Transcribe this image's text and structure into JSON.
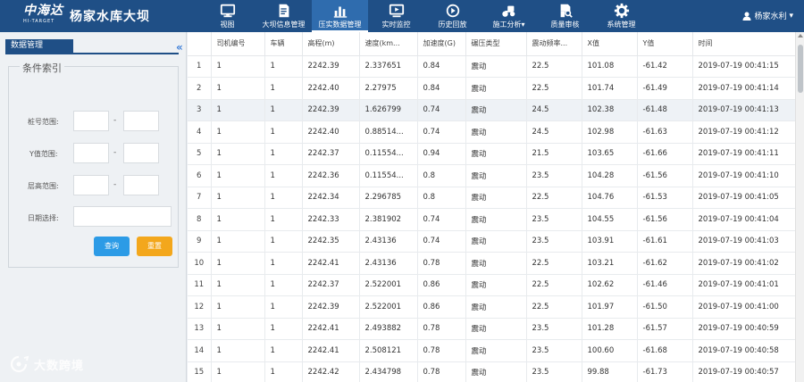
{
  "header": {
    "logo_main": "中海达",
    "logo_sub": "HI-TARGET",
    "title": "杨家水库大坝",
    "user": "杨家水利"
  },
  "nav": [
    {
      "label": "视图",
      "icon": "monitor-icon"
    },
    {
      "label": "大坝信息管理",
      "icon": "document-icon"
    },
    {
      "label": "压实数据管理",
      "icon": "bar-chart-icon",
      "active": true
    },
    {
      "label": "实时监控",
      "icon": "monitor-play-icon"
    },
    {
      "label": "历史回放",
      "icon": "replay-icon"
    },
    {
      "label": "施工分析",
      "icon": "roller-icon",
      "dropdown": true
    },
    {
      "label": "质量审核",
      "icon": "document-search-icon"
    },
    {
      "label": "系统管理",
      "icon": "gear-icon"
    }
  ],
  "sidebar": {
    "tab": "数据管理",
    "collapse": "«",
    "section": "条件索引",
    "fields": {
      "pile": "桩号范围:",
      "y": "Y值范围:",
      "height": "层高范围:",
      "date": "日期选择:"
    },
    "dash": "-",
    "query_btn": "查询",
    "reset_btn": "重置"
  },
  "table": {
    "columns": [
      "",
      "司机编号",
      "车辆",
      "高程(m)",
      "速度(km...",
      "加速度(G)",
      "碾压类型",
      "震动频率...",
      "X值",
      "Y值",
      "时间"
    ],
    "rows": [
      [
        "1",
        "1",
        "1",
        "2242.39",
        "2.337651",
        "0.84",
        "震动",
        "22.5",
        "101.08",
        "-61.42",
        "2019-07-19 00:41:15"
      ],
      [
        "2",
        "1",
        "1",
        "2242.40",
        "2.27975",
        "0.84",
        "震动",
        "22.5",
        "101.74",
        "-61.49",
        "2019-07-19 00:41:14"
      ],
      [
        "3",
        "1",
        "1",
        "2242.39",
        "1.626799",
        "0.74",
        "震动",
        "24.5",
        "102.38",
        "-61.48",
        "2019-07-19 00:41:13"
      ],
      [
        "4",
        "1",
        "1",
        "2242.40",
        "0.88514...",
        "0.74",
        "震动",
        "24.5",
        "102.98",
        "-61.63",
        "2019-07-19 00:41:12"
      ],
      [
        "5",
        "1",
        "1",
        "2242.37",
        "0.11554...",
        "0.94",
        "震动",
        "21.5",
        "103.65",
        "-61.66",
        "2019-07-19 00:41:11"
      ],
      [
        "6",
        "1",
        "1",
        "2242.36",
        "0.11554...",
        "0.8",
        "震动",
        "23.5",
        "104.28",
        "-61.56",
        "2019-07-19 00:41:10"
      ],
      [
        "7",
        "1",
        "1",
        "2242.34",
        "2.296785",
        "0.8",
        "震动",
        "22.5",
        "104.76",
        "-61.53",
        "2019-07-19 00:41:05"
      ],
      [
        "8",
        "1",
        "1",
        "2242.33",
        "2.381902",
        "0.74",
        "震动",
        "23.5",
        "104.55",
        "-61.56",
        "2019-07-19 00:41:04"
      ],
      [
        "9",
        "1",
        "1",
        "2242.35",
        "2.43136",
        "0.74",
        "震动",
        "23.5",
        "103.91",
        "-61.61",
        "2019-07-19 00:41:03"
      ],
      [
        "10",
        "1",
        "1",
        "2242.41",
        "2.43136",
        "0.78",
        "震动",
        "22.5",
        "103.21",
        "-61.62",
        "2019-07-19 00:41:02"
      ],
      [
        "11",
        "1",
        "1",
        "2242.37",
        "2.522001",
        "0.86",
        "震动",
        "22.5",
        "102.62",
        "-61.46",
        "2019-07-19 00:41:01"
      ],
      [
        "12",
        "1",
        "1",
        "2242.39",
        "2.522001",
        "0.86",
        "震动",
        "22.5",
        "101.97",
        "-61.50",
        "2019-07-19 00:41:00"
      ],
      [
        "13",
        "1",
        "1",
        "2242.41",
        "2.493882",
        "0.78",
        "震动",
        "23.5",
        "101.28",
        "-61.57",
        "2019-07-19 00:40:59"
      ],
      [
        "14",
        "1",
        "1",
        "2242.41",
        "2.508121",
        "0.78",
        "震动",
        "23.5",
        "100.60",
        "-61.68",
        "2019-07-19 00:40:58"
      ],
      [
        "15",
        "1",
        "1",
        "2242.42",
        "2.434798",
        "0.78",
        "震动",
        "23.5",
        "99.88",
        "-61.73",
        "2019-07-19 00:40:57"
      ]
    ],
    "highlight_row": 3
  },
  "watermark": "大数跨境",
  "colors": {
    "header": "#1f4f86",
    "nav_active": "#2f6cae",
    "query": "#2c9be6",
    "reset": "#f3a71c",
    "collapse": "#3b7dd8"
  }
}
